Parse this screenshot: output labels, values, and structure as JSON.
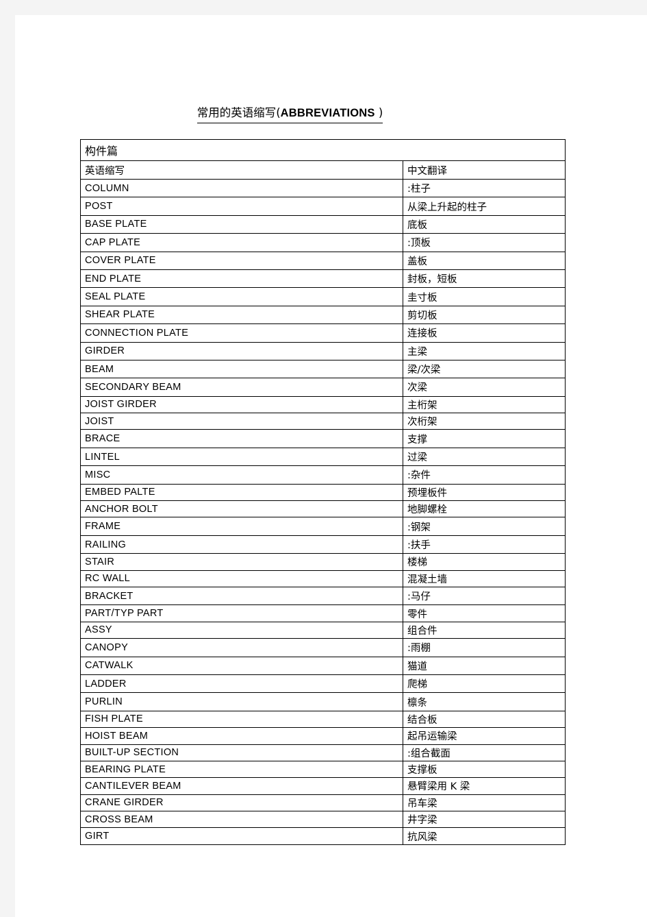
{
  "document": {
    "title_cn": "常用的英语缩写(",
    "title_en": "ABBREVIATIONS",
    "title_tail": " )"
  },
  "table": {
    "section_title": "构件篇",
    "columns": {
      "english": "英语缩写",
      "chinese": "中文翻译"
    },
    "rows": [
      {
        "en": "COLUMN",
        "cn": ":柱子",
        "tight": false
      },
      {
        "en": "POST",
        "cn": "从梁上升起的柱子",
        "tight": false
      },
      {
        "en": "BASE PLATE",
        "cn": "底板",
        "tight": false
      },
      {
        "en": "CAP PLATE",
        "cn": ":顶板",
        "tight": false
      },
      {
        "en": "COVER PLATE",
        "cn": "盖板",
        "tight": false
      },
      {
        "en": "END PLATE",
        "cn": "封板，短板",
        "tight": false
      },
      {
        "en": "SEAL PLATE",
        "cn": "圭寸板",
        "tight": false
      },
      {
        "en": "SHEAR PLATE",
        "cn": "剪切板",
        "tight": false
      },
      {
        "en": "CONNECTION PLATE",
        "cn": "连接板",
        "tight": false
      },
      {
        "en": "GIRDER",
        "cn": "主梁",
        "tight": false
      },
      {
        "en": "BEAM",
        "cn": "梁/次梁",
        "tight": false
      },
      {
        "en": "SECONDARY BEAM",
        "cn": "次梁",
        "tight": false
      },
      {
        "en": "JOIST GIRDER",
        "cn": "主桁架",
        "tight": true
      },
      {
        "en": "JOIST",
        "cn": "次桁架",
        "tight": true
      },
      {
        "en": "BRACE",
        "cn": "支撑",
        "tight": false
      },
      {
        "en": "LINTEL",
        "cn": "过梁",
        "tight": false
      },
      {
        "en": "MISC",
        "cn": ":杂件",
        "tight": false
      },
      {
        "en": "EMBED PALTE",
        "cn": "预埋板件",
        "tight": true
      },
      {
        "en": "ANCHOR BOLT",
        "cn": "地脚螺栓",
        "tight": true
      },
      {
        "en": "FRAME",
        "cn": ":钢架",
        "tight": false
      },
      {
        "en": "RAILING",
        "cn": ":扶手",
        "tight": false
      },
      {
        "en": "STAIR",
        "cn": "楼梯",
        "tight": true
      },
      {
        "en": "RC WALL",
        "cn": "混凝土墙",
        "tight": true
      },
      {
        "en": "BRACKET",
        "cn": ":马仔",
        "tight": false
      },
      {
        "en": "PART/TYP PART",
        "cn": "零件",
        "tight": true
      },
      {
        "en": "ASSY",
        "cn": "组合件",
        "tight": true
      },
      {
        "en": "CANOPY",
        "cn": ":雨棚",
        "tight": false
      },
      {
        "en": "CATWALK",
        "cn": "猫道",
        "tight": false
      },
      {
        "en": "LADDER",
        "cn": "爬梯",
        "tight": false
      },
      {
        "en": "PURLIN",
        "cn": "檩条",
        "tight": false
      },
      {
        "en": "FISH PLATE",
        "cn": "结合板",
        "tight": true
      },
      {
        "en": "HOIST BEAM",
        "cn": "起吊运输梁",
        "tight": true
      },
      {
        "en": "BUILT-UP SECTION",
        "cn": ":组合截面",
        "tight": true
      },
      {
        "en": "BEARING PLATE",
        "cn": "支撑板",
        "tight": true
      },
      {
        "en": "CANTILEVER BEAM",
        "cn": "悬臂梁用 K 梁",
        "tight": true
      },
      {
        "en": "CRANE GIRDER",
        "cn": "吊车梁",
        "tight": true
      },
      {
        "en": "CROSS BEAM",
        "cn": "井字梁",
        "tight": true
      },
      {
        "en": "GIRT",
        "cn": "抗风梁",
        "tight": true
      }
    ]
  }
}
